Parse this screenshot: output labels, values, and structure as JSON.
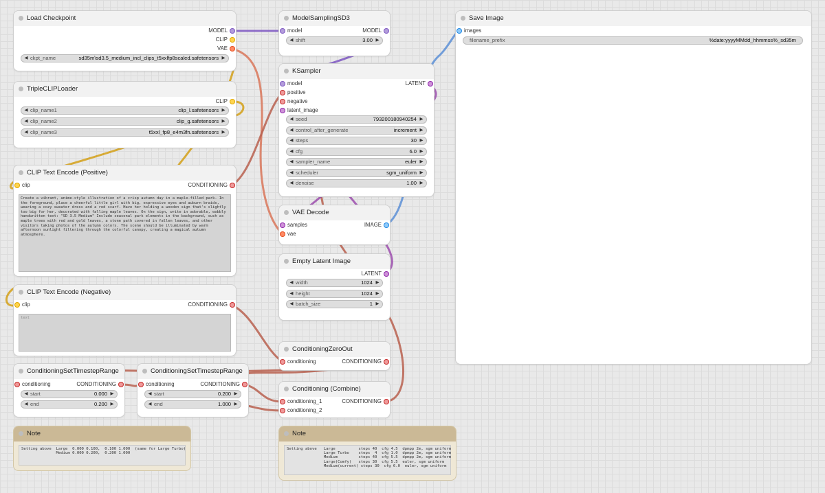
{
  "nodes": {
    "load_checkpoint": {
      "title": "Load Checkpoint",
      "outputs": [
        "MODEL",
        "CLIP",
        "VAE"
      ],
      "ckpt": {
        "label": "ckpt_name",
        "value": "sd35m\\sd3.5_medium_incl_clips_t5xxlfp8scaled.safetensors"
      }
    },
    "triple_clip": {
      "title": "TripleCLIPLoader",
      "output": "CLIP",
      "widgets": [
        {
          "label": "clip_name1",
          "value": "clip_l.safetensors"
        },
        {
          "label": "clip_name2",
          "value": "clip_g.safetensors"
        },
        {
          "label": "clip_name3",
          "value": "t5xxl_fp8_e4m3fn.safetensors"
        }
      ]
    },
    "clip_pos": {
      "title": "CLIP Text Encode (Positive)",
      "input": "clip",
      "output": "CONDITIONING",
      "text": "Create a vibrant, anime-style illustration of a crisp autumn day in a maple-filled park. In the foreground, place a cheerful little girl with big, expressive eyes and auburn braids, wearing a cozy sweater dress and a red scarf. Have her holding a wooden sign that's slightly too big for her, decorated with falling maple leaves. On the sign, write in adorable, wobbly handwritten text: \"SD 3.5 Medium\" Include seasonal park elements in the background, such as maple trees with red and gold leaves, a stone path covered in fallen leaves, and other visitors taking photos of the autumn colors. The scene should be illuminated by warm afternoon sunlight filtering through the colorful canopy, creating a magical autumn atmosphere."
    },
    "clip_neg": {
      "title": "CLIP Text Encode (Negative)",
      "input": "clip",
      "output": "CONDITIONING",
      "placeholder": "text"
    },
    "model_sampling": {
      "title": "ModelSamplingSD3",
      "input": "model",
      "output": "MODEL",
      "shift": {
        "label": "shift",
        "value": "3.00"
      }
    },
    "ksampler": {
      "title": "KSampler",
      "inputs": [
        "model",
        "positive",
        "negative",
        "latent_image"
      ],
      "output": "LATENT",
      "widgets": [
        {
          "label": "seed",
          "value": "793200180940254"
        },
        {
          "label": "control_after_generate",
          "value": "increment"
        },
        {
          "label": "steps",
          "value": "30"
        },
        {
          "label": "cfg",
          "value": "6.0"
        },
        {
          "label": "sampler_name",
          "value": "euler"
        },
        {
          "label": "scheduler",
          "value": "sgm_uniform"
        },
        {
          "label": "denoise",
          "value": "1.00"
        }
      ]
    },
    "vae_decode": {
      "title": "VAE Decode",
      "inputs": [
        "samples",
        "vae"
      ],
      "output": "IMAGE"
    },
    "empty_latent": {
      "title": "Empty Latent Image",
      "output": "LATENT",
      "widgets": [
        {
          "label": "width",
          "value": "1024"
        },
        {
          "label": "height",
          "value": "1024"
        },
        {
          "label": "batch_size",
          "value": "1"
        }
      ]
    },
    "cond_zero": {
      "title": "ConditioningZeroOut",
      "input": "conditioning",
      "output": "CONDITIONING"
    },
    "cond_combine": {
      "title": "Conditioning (Combine)",
      "inputs": [
        "conditioning_1",
        "conditioning_2"
      ],
      "output": "CONDITIONING"
    },
    "ts_range_1": {
      "title": "ConditioningSetTimestepRange",
      "input": "conditioning",
      "output": "CONDITIONING",
      "widgets": [
        {
          "label": "start",
          "value": "0.000"
        },
        {
          "label": "end",
          "value": "0.200"
        }
      ]
    },
    "ts_range_2": {
      "title": "ConditioningSetTimestepRange",
      "input": "conditioning",
      "output": "CONDITIONING",
      "widgets": [
        {
          "label": "start",
          "value": "0.200"
        },
        {
          "label": "end",
          "value": "1.000"
        }
      ]
    },
    "save_image": {
      "title": "Save Image",
      "input": "images",
      "prefix": {
        "label": "filename_prefix",
        "value": "%date:yyyyMMdd_hhmmss%_sd35m"
      }
    },
    "note_1": {
      "title": "Note",
      "text": "Setting above  Large  0.000 0.100,  0.100 1.000  (same for Large Turbo)\n               Medium 0.000 0.200,  0.200 1.000"
    },
    "note_2": {
      "title": "Note",
      "text": "Setting above   Large          steps 40  cfg 4.5  dpmpp 2m, sgm uniform\n                Large Turbo    steps  4  cfg 1.0  dpmpp 2m, sgm uniform\n                Medium         steps 40  cfg 5.5  dpmpp 2m, sgm uniform\n                Large(Comfy)   steps 30  cfg 5.5  euler, sgm uniform\n                Medium(current) steps 30  cfg 6.0  euler, sgm uniform"
    }
  },
  "link_colors": {
    "model": "#7e57c2",
    "clip": "#d4a017",
    "vae": "#d9775a",
    "conditioning": "#b8604f",
    "latent": "#9c4dae",
    "image": "#5c8fd6"
  }
}
